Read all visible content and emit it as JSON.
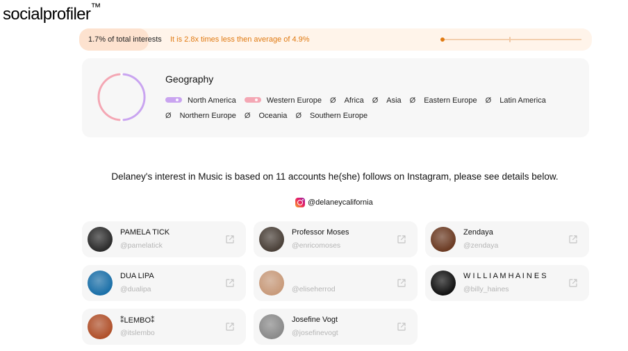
{
  "brand": {
    "name": "socialprofiler",
    "tm": "™"
  },
  "stat": {
    "share": "1.7% of total interests",
    "comparison": "It is 2.8x times less then average of 4.9%"
  },
  "geography": {
    "title": "Geography",
    "colors": {
      "north_america": "#c9a4f0",
      "western_europe": "#f4a7b4"
    },
    "ring_share": {
      "north_america": 0.5,
      "western_europe": 0.5
    },
    "regions": [
      {
        "label": "North America",
        "marker": "swatch",
        "color": "#c9a4f0"
      },
      {
        "label": "Western Europe",
        "marker": "swatch",
        "color": "#f4a7b4"
      },
      {
        "label": "Africa",
        "marker": "null",
        "symbol": "Ø"
      },
      {
        "label": "Asia",
        "marker": "null",
        "symbol": "Ø"
      },
      {
        "label": "Eastern Europe",
        "marker": "null",
        "symbol": "Ø"
      },
      {
        "label": "Latin America",
        "marker": "null",
        "symbol": "Ø"
      },
      {
        "label": "Northern Europe",
        "marker": "null",
        "symbol": "Ø"
      },
      {
        "label": "Oceania",
        "marker": "null",
        "symbol": "Ø"
      },
      {
        "label": "Southern Europe",
        "marker": "null",
        "symbol": "Ø"
      }
    ]
  },
  "headline": "Delaney's interest in Music is based on 11 accounts he(she) follows on Instagram, please see details below.",
  "instagram_handle": "@delaneycalifornia",
  "accounts": [
    {
      "name": "PAMELA TICK",
      "username": "@pamelatick",
      "avatar": "#2b2b2b"
    },
    {
      "name": "Professor Moses",
      "username": "@enricomoses",
      "avatar": "#4a4038"
    },
    {
      "name": "Zendaya",
      "username": "@zendaya",
      "avatar": "#6b3a22"
    },
    {
      "name": "DUA LIPA",
      "username": "@dualipa",
      "avatar": "#1a6fa8"
    },
    {
      "name": "",
      "username": "@eliseherrod",
      "avatar": "#c89a7a"
    },
    {
      "name": "W I L L I A M H A I N E S",
      "username": "@billy_haines",
      "avatar": "#111111"
    },
    {
      "name": "⁑LEMBO⁑",
      "username": "@itslembo",
      "avatar": "#b0502a"
    },
    {
      "name": "Josefine Vogt",
      "username": "@josefinevogt",
      "avatar": "#8a8a8a"
    }
  ]
}
